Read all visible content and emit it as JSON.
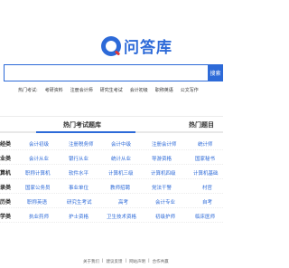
{
  "logo": {
    "text": "问答库"
  },
  "search": {
    "placeholder": "",
    "button_label": "搜索"
  },
  "hot": {
    "label": "热门考试:",
    "items": [
      "考研资料",
      "注册会计师",
      "研究生考试",
      "会计初级",
      "职称英语",
      "公文写作"
    ]
  },
  "tabs": {
    "main": "热门考试题库",
    "side": "热门题目"
  },
  "grid": {
    "rows": [
      {
        "category": "经类",
        "cells": [
          "会计初级",
          "注册税务师",
          "会计中级",
          "注册会计师",
          "统计师"
        ]
      },
      {
        "category": "业类",
        "cells": [
          "会计从业",
          "银行从业",
          "统计从业",
          "导游资格",
          "国家秘书"
        ]
      },
      {
        "category": "算机",
        "cells": [
          "职称计算机",
          "软件水平",
          "计算机三级",
          "计算机四级",
          "计算机基础"
        ]
      },
      {
        "category": "录类",
        "cells": [
          "国家公务员",
          "事业单位",
          "教师招聘",
          "党法干警",
          "村官"
        ]
      },
      {
        "category": "历类",
        "cells": [
          "职称英语",
          "研究生考试",
          "高考",
          "会计专业",
          "自考"
        ]
      },
      {
        "category": "学类",
        "cells": [
          "执业药师",
          "护士资格",
          "卫生技术资格",
          "初级护师",
          "临床医师"
        ]
      }
    ]
  },
  "footer": {
    "links": [
      "关于我们",
      "|",
      "建议反馈",
      "|",
      "网站声明",
      "|",
      "合作共赢"
    ]
  }
}
